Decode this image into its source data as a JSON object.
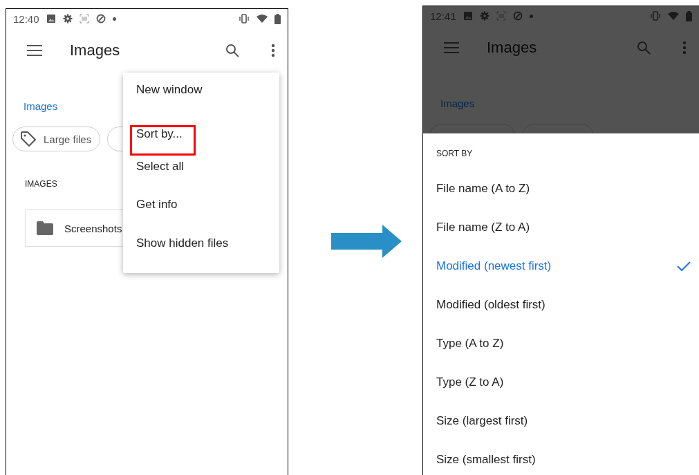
{
  "left_screen": {
    "status_time": "12:40",
    "title": "Images",
    "breadcrumb": "Images",
    "chips": [
      {
        "label": "Large files"
      }
    ],
    "section_header": "IMAGES",
    "folders": [
      {
        "name": "Screenshots"
      }
    ],
    "menu": [
      {
        "label": "New window",
        "highlighted": false
      },
      {
        "label": "Sort by...",
        "highlighted": true
      },
      {
        "label": "Select all",
        "highlighted": false
      },
      {
        "label": "Get info",
        "highlighted": false
      },
      {
        "label": "Show hidden files",
        "highlighted": false
      }
    ]
  },
  "right_screen": {
    "status_time": "12:41",
    "title": "Images",
    "breadcrumb": "Images",
    "sheet_title": "SORT BY",
    "options": [
      {
        "label": "File name (A to Z)",
        "selected": false
      },
      {
        "label": "File name (Z to A)",
        "selected": false
      },
      {
        "label": "Modified (newest first)",
        "selected": true
      },
      {
        "label": "Modified (oldest first)",
        "selected": false
      },
      {
        "label": "Type (A to Z)",
        "selected": false
      },
      {
        "label": "Type (Z to A)",
        "selected": false
      },
      {
        "label": "Size (largest first)",
        "selected": false
      },
      {
        "label": "Size (smallest first)",
        "selected": false
      }
    ]
  }
}
